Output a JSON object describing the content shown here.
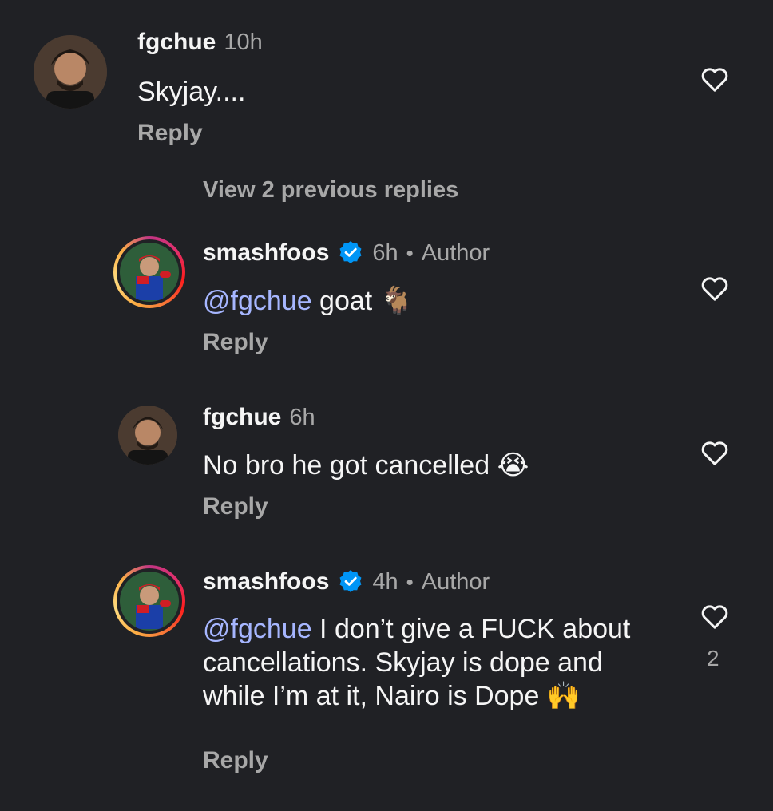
{
  "comments": [
    {
      "username": "fgchue",
      "time": "10h",
      "text": "Skyjay....",
      "reply": "Reply"
    },
    {
      "username": "smashfoos",
      "time": "6h",
      "dot": "•",
      "author": "Author",
      "mention": "@fgchue",
      "text": " goat 🐐",
      "reply": "Reply"
    },
    {
      "username": "fgchue",
      "time": "6h",
      "text": "No bro he got cancelled 😭",
      "reply": "Reply"
    },
    {
      "username": "smashfoos",
      "time": "4h",
      "dot": "•",
      "author": "Author",
      "mention": "@fgchue",
      "text": " I don’t give a FUCK about cancellations. Skyjay is dope and while I’m at it, Nairo is Dope 🙌",
      "reply": "Reply",
      "likes": "2"
    }
  ],
  "view_replies": "View 2 previous replies",
  "colors": {
    "background": "#202125",
    "mention": "#a6b6ff",
    "muted": "#a8a8a8",
    "verified": "#0095f6"
  }
}
